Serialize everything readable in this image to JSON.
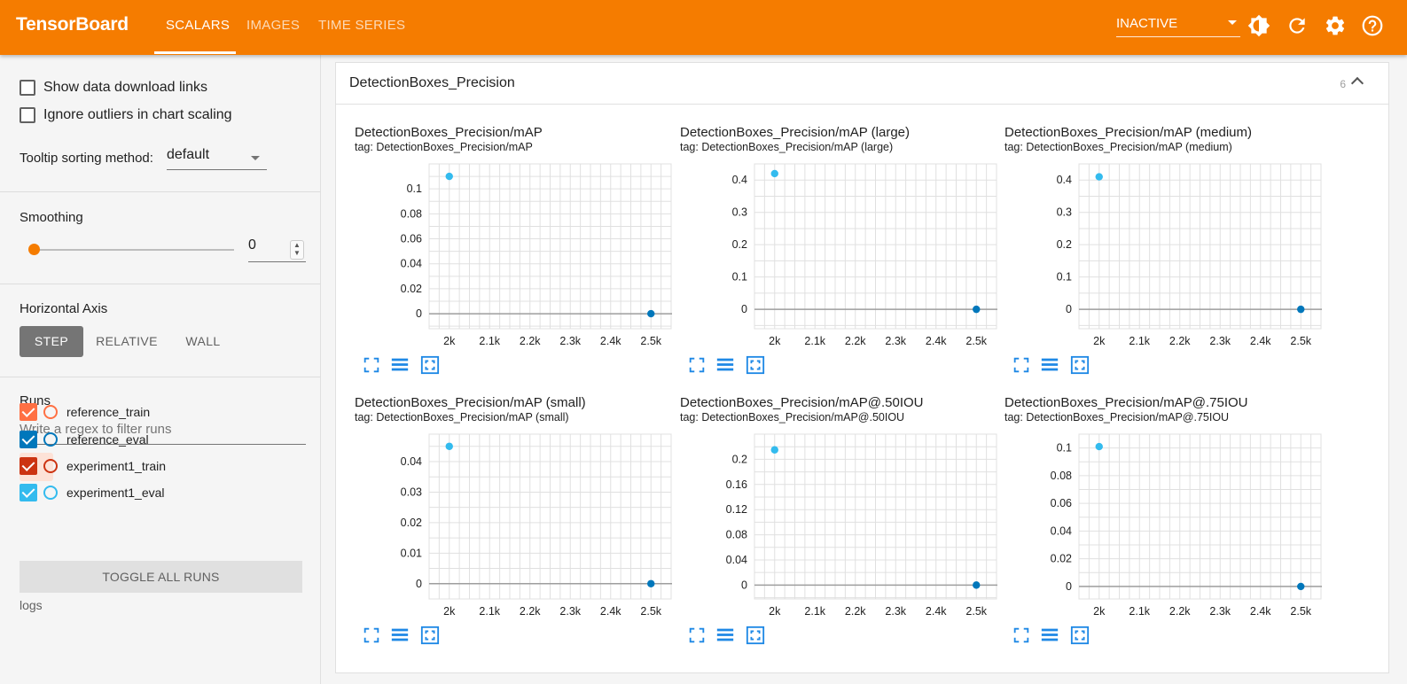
{
  "header": {
    "brand": "TensorBoard",
    "tabs": [
      {
        "label": "SCALARS",
        "active": true
      },
      {
        "label": "IMAGES",
        "active": false
      },
      {
        "label": "TIME SERIES",
        "active": false
      }
    ],
    "status": "INACTIVE",
    "icons": [
      "brightness-icon",
      "refresh-icon",
      "settings-icon",
      "help-icon"
    ],
    "accent_color": "#f57c00"
  },
  "sidebar": {
    "show_download_links": {
      "label": "Show data download links",
      "checked": false
    },
    "ignore_outliers": {
      "label": "Ignore outliers in chart scaling",
      "checked": false
    },
    "tooltip_sorting": {
      "label": "Tooltip sorting method:",
      "value": "default"
    },
    "smoothing": {
      "label": "Smoothing",
      "value": "0"
    },
    "horizontal_axis": {
      "label": "Horizontal Axis",
      "options": [
        "STEP",
        "RELATIVE",
        "WALL"
      ],
      "selected": "STEP"
    },
    "runs": {
      "label": "Runs",
      "filter_placeholder": "Write a regex to filter runs",
      "items": [
        {
          "name": "reference_train",
          "checked": true,
          "color": "#ff7043"
        },
        {
          "name": "reference_eval",
          "checked": true,
          "color": "#0077bb"
        },
        {
          "name": "experiment1_train",
          "checked": true,
          "color": "#cc3311"
        },
        {
          "name": "experiment1_eval",
          "checked": true,
          "color": "#33bbee"
        }
      ],
      "toggle_label": "TOGGLE ALL RUNS",
      "logdir": "logs"
    }
  },
  "main": {
    "group_title": "DetectionBoxes_Precision",
    "group_count": "6"
  },
  "chart_data": [
    {
      "type": "scatter",
      "title": "DetectionBoxes_Precision/mAP",
      "tag": "tag: DetectionBoxes_Precision/mAP",
      "xticks": [
        "2k",
        "2.1k",
        "2.2k",
        "2.3k",
        "2.4k",
        "2.5k"
      ],
      "xlim": [
        1950,
        2550
      ],
      "yticks": [
        "0",
        "0.02",
        "0.04",
        "0.06",
        "0.08",
        "0.1"
      ],
      "ylim": [
        -0.012,
        0.12
      ],
      "series": [
        {
          "color": "#33bbee",
          "points": [
            [
              2000,
              0.11
            ]
          ]
        },
        {
          "color": "#0077bb",
          "points": [
            [
              2500,
              0.0
            ]
          ]
        }
      ]
    },
    {
      "type": "scatter",
      "title": "DetectionBoxes_Precision/mAP (large)",
      "tag": "tag: DetectionBoxes_Precision/mAP (large)",
      "xticks": [
        "2k",
        "2.1k",
        "2.2k",
        "2.3k",
        "2.4k",
        "2.5k"
      ],
      "xlim": [
        1950,
        2550
      ],
      "yticks": [
        "0",
        "0.1",
        "0.2",
        "0.3",
        "0.4"
      ],
      "ylim": [
        -0.06,
        0.45
      ],
      "series": [
        {
          "color": "#33bbee",
          "points": [
            [
              2000,
              0.42
            ]
          ]
        },
        {
          "color": "#0077bb",
          "points": [
            [
              2500,
              0.0
            ]
          ]
        }
      ]
    },
    {
      "type": "scatter",
      "title": "DetectionBoxes_Precision/mAP (medium)",
      "tag": "tag: DetectionBoxes_Precision/mAP (medium)",
      "xticks": [
        "2k",
        "2.1k",
        "2.2k",
        "2.3k",
        "2.4k",
        "2.5k"
      ],
      "xlim": [
        1950,
        2550
      ],
      "yticks": [
        "0",
        "0.1",
        "0.2",
        "0.3",
        "0.4"
      ],
      "ylim": [
        -0.06,
        0.45
      ],
      "series": [
        {
          "color": "#33bbee",
          "points": [
            [
              2000,
              0.41
            ]
          ]
        },
        {
          "color": "#0077bb",
          "points": [
            [
              2500,
              0.0
            ]
          ]
        }
      ]
    },
    {
      "type": "scatter",
      "title": "DetectionBoxes_Precision/mAP (small)",
      "tag": "tag: DetectionBoxes_Precision/mAP (small)",
      "xticks": [
        "2k",
        "2.1k",
        "2.2k",
        "2.3k",
        "2.4k",
        "2.5k"
      ],
      "xlim": [
        1950,
        2550
      ],
      "yticks": [
        "0",
        "0.01",
        "0.02",
        "0.03",
        "0.04"
      ],
      "ylim": [
        -0.005,
        0.049
      ],
      "series": [
        {
          "color": "#33bbee",
          "points": [
            [
              2000,
              0.045
            ]
          ]
        },
        {
          "color": "#0077bb",
          "points": [
            [
              2500,
              0.0
            ]
          ]
        }
      ]
    },
    {
      "type": "scatter",
      "title": "DetectionBoxes_Precision/mAP@.50IOU",
      "tag": "tag: DetectionBoxes_Precision/mAP@.50IOU",
      "xticks": [
        "2k",
        "2.1k",
        "2.2k",
        "2.3k",
        "2.4k",
        "2.5k"
      ],
      "xlim": [
        1950,
        2550
      ],
      "yticks": [
        "0",
        "0.04",
        "0.08",
        "0.12",
        "0.16",
        "0.2"
      ],
      "ylim": [
        -0.022,
        0.24
      ],
      "series": [
        {
          "color": "#33bbee",
          "points": [
            [
              2000,
              0.215
            ]
          ]
        },
        {
          "color": "#0077bb",
          "points": [
            [
              2500,
              0.0
            ]
          ]
        }
      ]
    },
    {
      "type": "scatter",
      "title": "DetectionBoxes_Precision/mAP@.75IOU",
      "tag": "tag: DetectionBoxes_Precision/mAP@.75IOU",
      "xticks": [
        "2k",
        "2.1k",
        "2.2k",
        "2.3k",
        "2.4k",
        "2.5k"
      ],
      "xlim": [
        1950,
        2550
      ],
      "yticks": [
        "0",
        "0.02",
        "0.04",
        "0.06",
        "0.08",
        "0.1"
      ],
      "ylim": [
        -0.009,
        0.11
      ],
      "series": [
        {
          "color": "#33bbee",
          "points": [
            [
              2000,
              0.101
            ]
          ]
        },
        {
          "color": "#0077bb",
          "points": [
            [
              2500,
              0.0
            ]
          ]
        }
      ]
    }
  ]
}
